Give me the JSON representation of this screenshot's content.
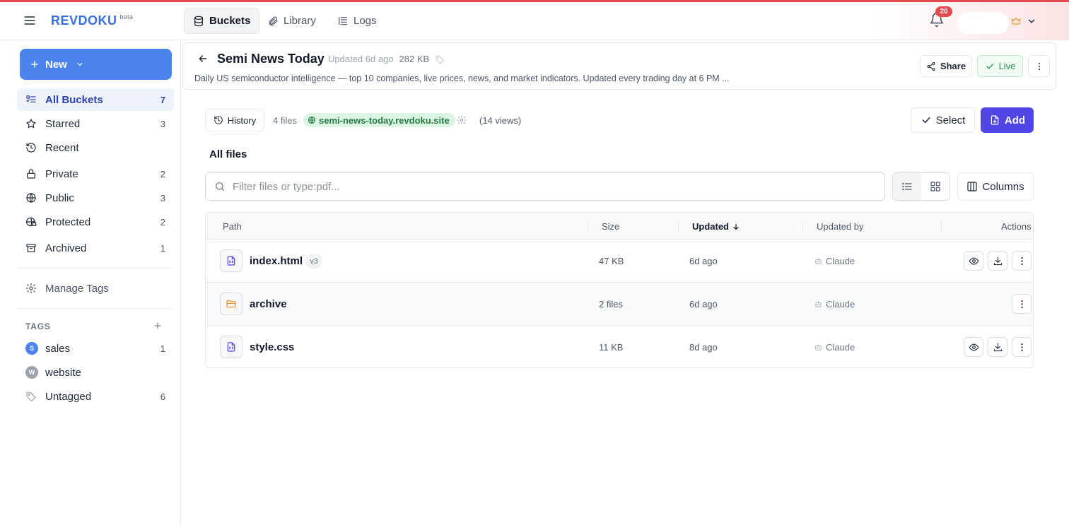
{
  "app": {
    "logo": "REVDOKU",
    "logo_badge": "beta"
  },
  "nav": {
    "tabs": [
      {
        "label": "Buckets",
        "icon": "database-icon",
        "active": true
      },
      {
        "label": "Library",
        "icon": "paperclip-icon",
        "active": false
      },
      {
        "label": "Logs",
        "icon": "logs-icon",
        "active": false
      }
    ],
    "notifications": "20"
  },
  "sidebar": {
    "new_label": "New",
    "items": [
      {
        "label": "All Buckets",
        "count": "7",
        "icon": "list-icon"
      },
      {
        "label": "Starred",
        "count": "3",
        "icon": "star-icon"
      },
      {
        "label": "Recent",
        "count": "",
        "icon": "history-icon"
      },
      {
        "label": "Private",
        "count": "2",
        "icon": "lock-icon"
      },
      {
        "label": "Public",
        "count": "3",
        "icon": "globe-icon"
      },
      {
        "label": "Protected",
        "count": "2",
        "icon": "globe-lock-icon"
      },
      {
        "label": "Archived",
        "count": "1",
        "icon": "archive-icon"
      }
    ],
    "manage_tags": "Manage Tags",
    "tags_title": "TAGS",
    "tags": [
      {
        "label": "sales",
        "count": "1",
        "initial": "S",
        "color": "#4a84ec"
      },
      {
        "label": "website",
        "count": "",
        "initial": "W",
        "color": "#9ca3af"
      },
      {
        "label": "Untagged",
        "count": "6"
      }
    ]
  },
  "bucket": {
    "title": "Semi News Today",
    "updated": "Updated 6d ago",
    "size": "282 KB",
    "description": "Daily US semiconductor intelligence — top 10 companies, live prices, news, and market indicators. Updated every trading day at 6 PM ...",
    "share_label": "Share",
    "live_label": "Live"
  },
  "toolbar": {
    "history_label": "History",
    "files_count": "4 files",
    "site": "semi-news-today.revdoku.site",
    "views": "(14 views)",
    "select_label": "Select",
    "add_label": "Add"
  },
  "files": {
    "heading": "All files",
    "search_placeholder": "Filter files or type:pdf...",
    "columns_label": "Columns",
    "headers": {
      "path": "Path",
      "size": "Size",
      "updated": "Updated",
      "updated_by": "Updated by",
      "actions": "Actions"
    },
    "rows": [
      {
        "name": "index.html",
        "version": "v3",
        "size": "47 KB",
        "updated": "6d ago",
        "by": "Claude",
        "kind": "file"
      },
      {
        "name": "archive",
        "version": "",
        "size": "2 files",
        "updated": "6d ago",
        "by": "Claude",
        "kind": "folder"
      },
      {
        "name": "style.css",
        "version": "",
        "size": "11 KB",
        "updated": "8d ago",
        "by": "Claude",
        "kind": "file"
      }
    ]
  },
  "colors": {
    "accent": "#4f46e5",
    "new_button": "#4a84ec",
    "live": "#2f8a4e",
    "alert": "#e5484d"
  }
}
